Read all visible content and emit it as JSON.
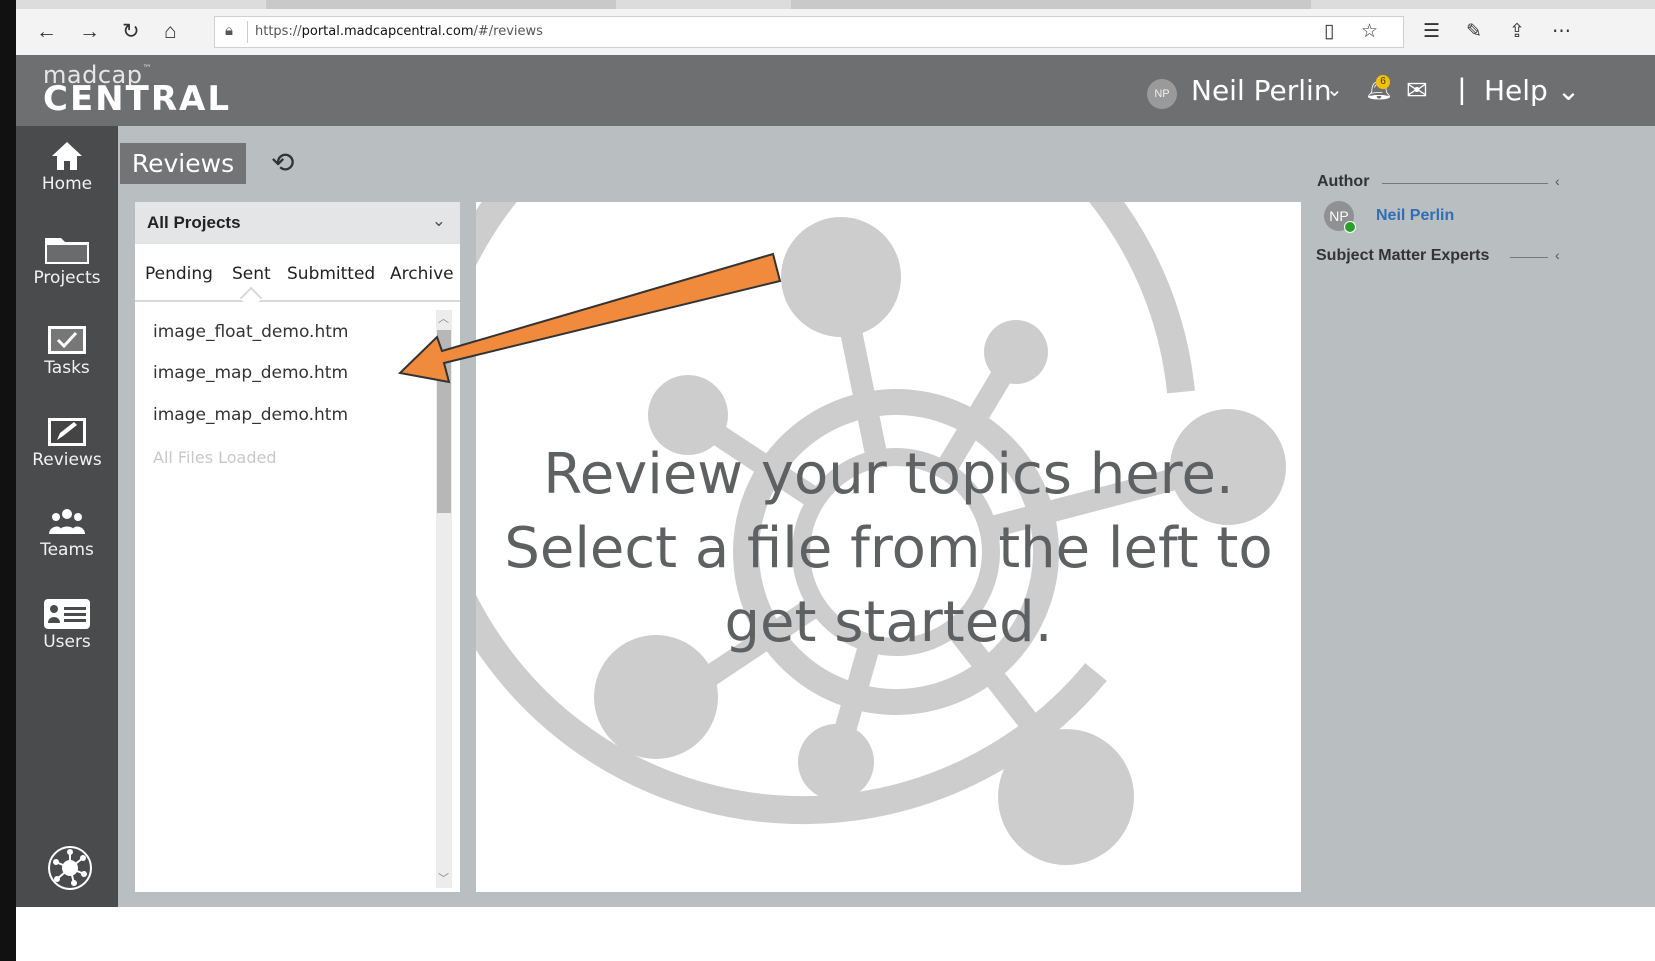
{
  "browser": {
    "url_prefix": "https://",
    "url_host": "portal.madcapcentral.com",
    "url_path": "/#/reviews"
  },
  "header": {
    "logo_top": "madcap",
    "logo_tm": "™",
    "logo_bottom": "CENTRAL",
    "user_initials": "NP",
    "user_name": "Neil Perlin",
    "notification_count": "6",
    "help_label": "Help",
    "separator": "|"
  },
  "nav": {
    "items": [
      {
        "label": "Home"
      },
      {
        "label": "Projects"
      },
      {
        "label": "Tasks"
      },
      {
        "label": "Reviews"
      },
      {
        "label": "Teams"
      },
      {
        "label": "Users"
      }
    ]
  },
  "reviews": {
    "title": "Reviews",
    "project_filter": "All Projects",
    "tabs": [
      "Pending",
      "Sent",
      "Submitted",
      "Archive"
    ],
    "active_tab": "Sent",
    "files": [
      "image_float_demo.htm",
      "image_map_demo.htm",
      "image_map_demo.htm"
    ],
    "status": "All Files Loaded"
  },
  "center": {
    "line1": "Review your topics here.",
    "line2": "Select a file from the left to",
    "line3": "get started."
  },
  "right": {
    "author_heading": "Author",
    "author_initials": "NP",
    "author_name": "Neil Perlin",
    "sme_heading": "Subject Matter Experts"
  },
  "colors": {
    "header_bg": "#6e6f70",
    "nav_bg": "#4a4b4c",
    "main_bg": "#b9bec0",
    "arrow": "#f08a3c",
    "link": "#2e6fb5"
  }
}
